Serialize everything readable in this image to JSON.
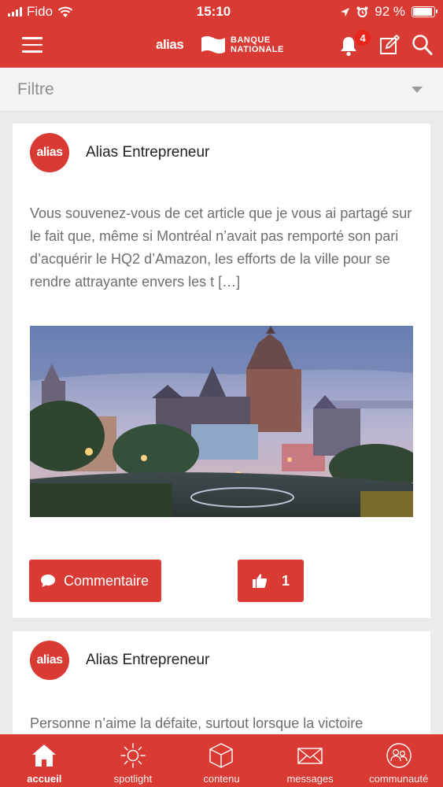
{
  "status_bar": {
    "carrier": "Fido",
    "time": "15:10",
    "battery_percent": "92 %",
    "battery_level": 0.92
  },
  "app_bar": {
    "menu_icon": "hamburger-menu-icon",
    "logo_alias": "alias",
    "logo_bank_line1": "BANQUE",
    "logo_bank_line2": "NATIONALE",
    "notification_count": "4"
  },
  "filter": {
    "label": "Filtre"
  },
  "posts": [
    {
      "avatar_text": "alias",
      "author": "Alias Entrepreneur",
      "text": "Vous souvenez-vous de cet article que je vous ai partagé sur le fait que, même si Montréal n’avait pas remporté son pari d’acquérir le HQ2 d’Amazon, les efforts de la ville pour se rendre attrayante envers les t […]",
      "comment_label": "Commentaire",
      "like_count": "1"
    },
    {
      "avatar_text": "alias",
      "author": "Alias Entrepreneur",
      "text": "Personne n’aime la défaite, surtout lorsque la victoire"
    }
  ],
  "tabs": [
    {
      "label": "accueil",
      "icon": "home-icon",
      "active": true
    },
    {
      "label": "spotlight",
      "icon": "sun-icon",
      "active": false
    },
    {
      "label": "contenu",
      "icon": "cube-icon",
      "active": false
    },
    {
      "label": "messages",
      "icon": "envelope-icon",
      "active": false
    },
    {
      "label": "communauté",
      "icon": "community-icon",
      "active": false
    }
  ],
  "colors": {
    "brand_red": "#d93a34",
    "badge_red": "#e8261b",
    "background": "#ebebeb"
  }
}
